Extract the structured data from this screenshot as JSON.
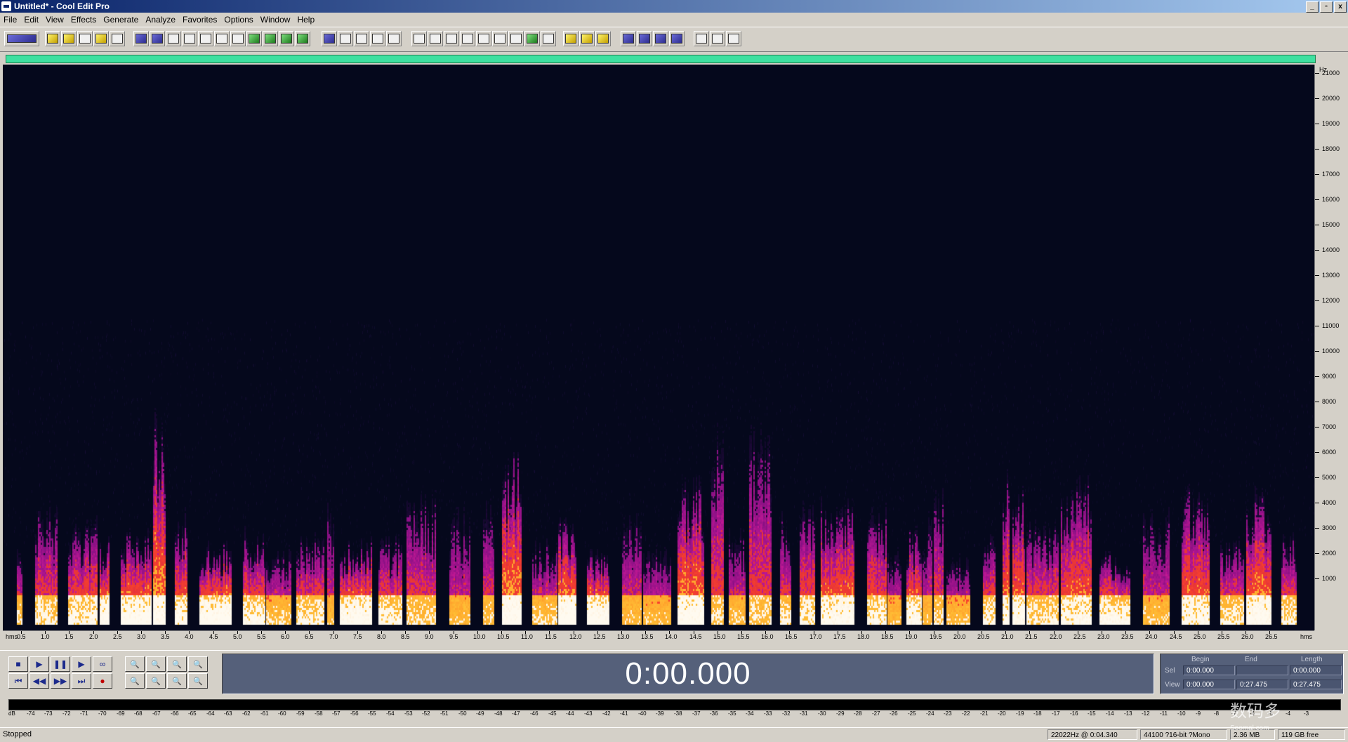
{
  "window": {
    "title": "Untitled* - Cool Edit Pro",
    "buttons": [
      "_",
      "▫",
      "x"
    ]
  },
  "menu": [
    "File",
    "Edit",
    "View",
    "Effects",
    "Generate",
    "Analyze",
    "Favorites",
    "Options",
    "Window",
    "Help"
  ],
  "spectral_axis": {
    "unit": "Hz",
    "labels": [
      "21000",
      "20000",
      "19000",
      "18000",
      "17000",
      "16000",
      "15000",
      "14000",
      "13000",
      "12000",
      "11000",
      "10000",
      "9000",
      "8000",
      "7000",
      "6000",
      "5000",
      "4000",
      "3000",
      "2000",
      "1000"
    ]
  },
  "time_ruler": {
    "unit_left": "hms",
    "unit_right": "hms",
    "labels": [
      "0.5",
      "1.0",
      "1.5",
      "2.0",
      "2.5",
      "3.0",
      "3.5",
      "4.0",
      "4.5",
      "5.0",
      "5.5",
      "6.0",
      "6.5",
      "7.0",
      "7.5",
      "8.0",
      "8.5",
      "9.0",
      "9.5",
      "10.0",
      "10.5",
      "11.0",
      "11.5",
      "12.0",
      "12.5",
      "13.0",
      "13.5",
      "14.0",
      "14.5",
      "15.0",
      "15.5",
      "16.0",
      "16.5",
      "17.0",
      "17.5",
      "18.0",
      "18.5",
      "19.0",
      "19.5",
      "20.0",
      "20.5",
      "21.0",
      "21.5",
      "22.0",
      "22.5",
      "23.0",
      "23.5",
      "24.0",
      "24.5",
      "25.0",
      "25.5",
      "26.0",
      "26.5"
    ]
  },
  "transport": {
    "time": "0:00.000",
    "buttons": [
      "stop",
      "play",
      "pause",
      "play-to-end",
      "loop",
      "go-to-start",
      "rewind",
      "fast-forward",
      "go-to-end",
      "record"
    ],
    "glyphs": [
      "■",
      "▶",
      "❚❚",
      "▶",
      "∞",
      "⏮",
      "◀◀",
      "▶▶",
      "⏭",
      "●"
    ]
  },
  "zoom": {
    "buttons": [
      "zoom-in",
      "zoom-out",
      "zoom-full",
      "zoom-in-full",
      "zoom-left",
      "zoom-right",
      "zoom-selection",
      "zoom-out-full"
    ],
    "glyphs": [
      "🔍",
      "🔍",
      "🔍",
      "🔍",
      "🔍",
      "🔍",
      "🔍",
      "🔍"
    ]
  },
  "selection": {
    "headers": {
      "begin": "Begin",
      "end": "End",
      "length": "Length"
    },
    "sel": {
      "label": "Sel",
      "begin": "0:00.000",
      "end": "",
      "length": "0:00.000"
    },
    "view": {
      "label": "View",
      "begin": "0:00.000",
      "end": "0:27.475",
      "length": "0:27.475"
    }
  },
  "level_meter": {
    "labels": [
      "dB",
      "-74",
      "-73",
      "-72",
      "-71",
      "-70",
      "-69",
      "-68",
      "-67",
      "-66",
      "-65",
      "-64",
      "-63",
      "-62",
      "-61",
      "-60",
      "-59",
      "-58",
      "-57",
      "-56",
      "-55",
      "-54",
      "-53",
      "-52",
      "-51",
      "-50",
      "-49",
      "-48",
      "-47",
      "-46",
      "-45",
      "-44",
      "-43",
      "-42",
      "-41",
      "-40",
      "-39",
      "-38",
      "-37",
      "-36",
      "-35",
      "-34",
      "-33",
      "-32",
      "-31",
      "-30",
      "-29",
      "-28",
      "-27",
      "-26",
      "-25",
      "-24",
      "-23",
      "-22",
      "-21",
      "-20",
      "-19",
      "-18",
      "-17",
      "-16",
      "-15",
      "-14",
      "-13",
      "-12",
      "-11",
      "-10",
      "-9",
      "-8",
      "-7",
      "-6",
      "-5",
      "-4",
      "-3"
    ]
  },
  "status": {
    "state": "Stopped",
    "cursor": "22022Hz @  0:04.340",
    "format": "44100 ?16-bit ?Mono",
    "size": "2.36 MB",
    "free": "119 GB free"
  },
  "watermark": {
    "main": "数码多",
    "sub": "Soomal.com"
  }
}
